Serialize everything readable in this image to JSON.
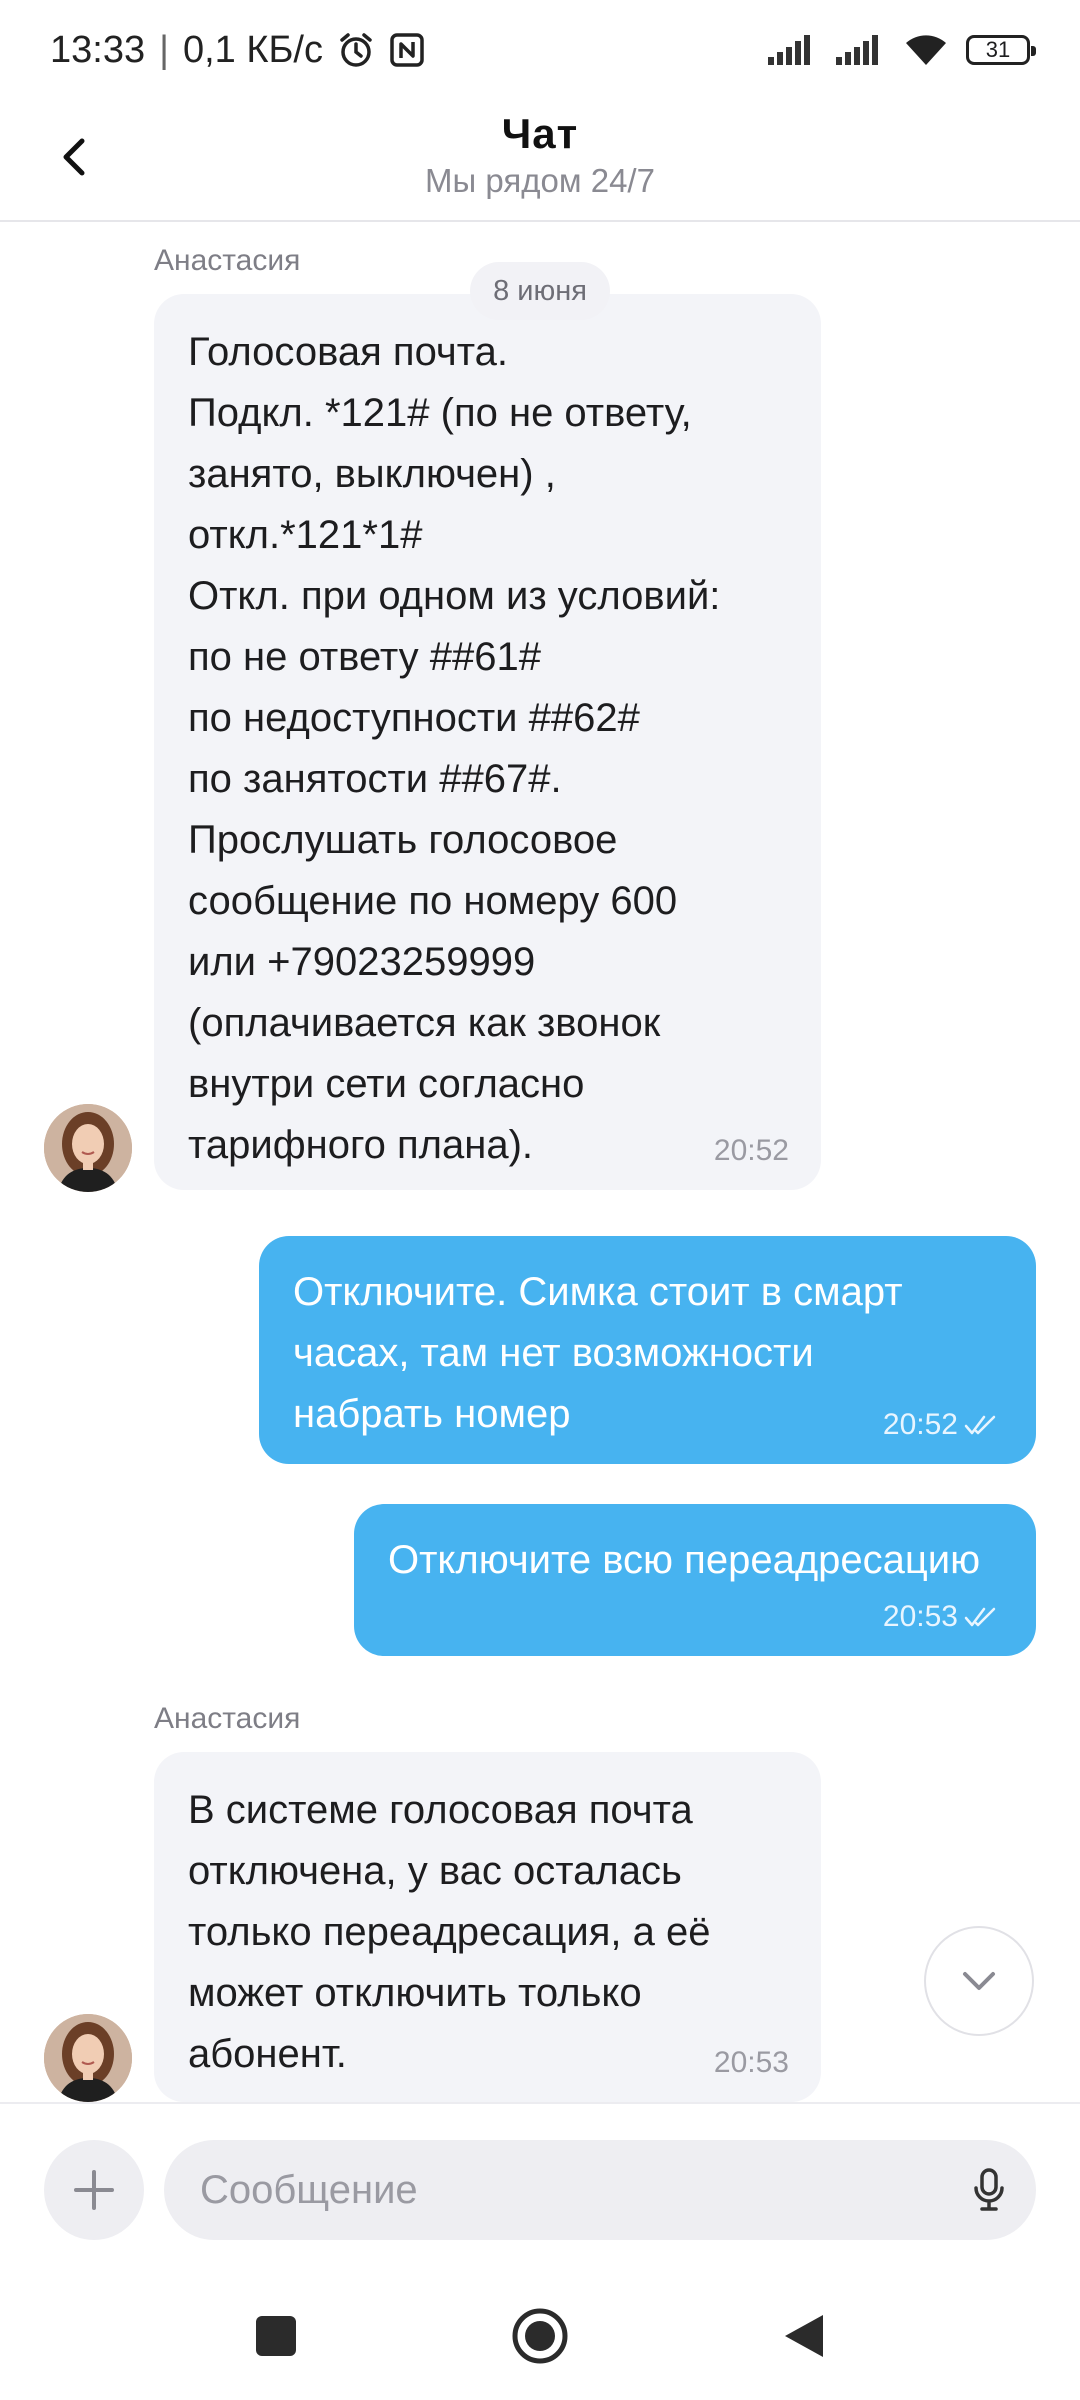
{
  "status_bar": {
    "time": "13:33",
    "separator": "|",
    "speed": "0,1 КБ/с",
    "battery": "31"
  },
  "header": {
    "title": "Чат",
    "subtitle": "Мы рядом 24/7"
  },
  "chat": {
    "date_separator": "8 июня",
    "messages": [
      {
        "direction": "incoming",
        "sender": "Анастасия",
        "text": "Голосовая почта.\nПодкл. *121# (по не ответу,\nзанято, выключен) ,\nоткл.*121*1#\nОткл. при одном из условий:\nпо не ответу ##61#\nпо недоступности ##62#\nпо занятости ##67#.\nПрослушать голосовое\nсообщение по номеру 600\nили +79023259999\n(оплачивается как звонок\nвнутри сети согласно\nтарифного плана).",
        "time": "20:52"
      },
      {
        "direction": "outgoing",
        "text": "Отключите. Симка стоит в смарт\nчасах, там нет возможности\nнабрать номер",
        "time": "20:52",
        "status": "read"
      },
      {
        "direction": "outgoing",
        "text": "Отключите всю переадресацию",
        "time": "20:53",
        "status": "read"
      },
      {
        "direction": "incoming",
        "sender": "Анастасия",
        "text": "В системе голосовая почта\nотключена, у вас осталась\nтолько переадресация, а её\nможет отключить только\nабонент.",
        "time": "20:53"
      }
    ]
  },
  "composer": {
    "placeholder": "Сообщение",
    "value": ""
  },
  "colors": {
    "outgoing_bubble": "#47b3f0",
    "incoming_bubble": "#f3f4f8",
    "muted_text": "#9a9aa2"
  },
  "icons": {
    "back": "chevron-left-icon",
    "alarm": "alarm-icon",
    "nfc": "nfc-icon",
    "signal": "signal-icon",
    "wifi": "wifi-icon",
    "battery": "battery-icon",
    "read": "double-check-icon",
    "scroll_down": "chevron-down-icon",
    "add": "plus-icon",
    "mic": "microphone-icon",
    "nav_recents": "square-icon",
    "nav_home": "circle-icon",
    "nav_back": "triangle-icon"
  }
}
